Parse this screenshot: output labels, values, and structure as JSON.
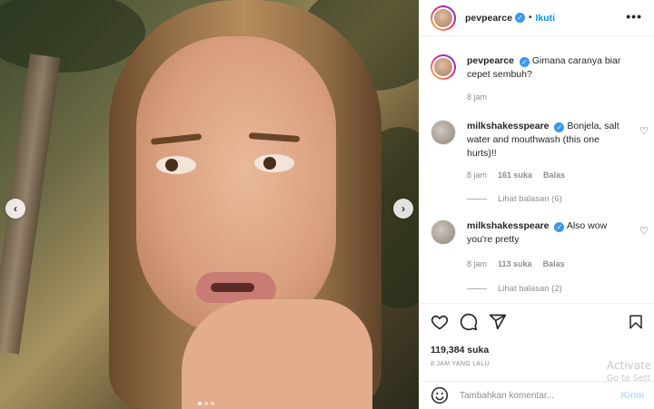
{
  "post": {
    "username": "pevpearce",
    "separator": "•",
    "follow_label": "Ikuti",
    "more_label": "•••",
    "image_alt": "photo of a woman touching her lip",
    "carousel": {
      "count": 3,
      "active": 1
    },
    "prev_label": "‹",
    "next_label": "›"
  },
  "caption": {
    "username": "pevpearce",
    "text": "Gimana caranya biar cepet sembuh?",
    "time": "8 jam"
  },
  "comments": [
    {
      "username": "milkshakesspeare",
      "text": "Bonjela, salt water and mouthwash (this one hurts)!!",
      "time": "8 jam",
      "likes": "161 suka",
      "reply_label": "Balas",
      "view_replies": "Lihat balasan (6)"
    },
    {
      "username": "milkshakesspeare",
      "text": "Also wow you're pretty",
      "time": "8 jam",
      "likes": "113 suka",
      "reply_label": "Balas",
      "view_replies": "Lihat balasan (2)"
    }
  ],
  "actions": {
    "likes": "119,384 suka",
    "timestamp": "8 JAM YANG LALU"
  },
  "composer": {
    "placeholder": "Tambahkan komentar...",
    "post_label": "Kirim"
  },
  "watermark": {
    "line1": "Activate",
    "line2": "Go to Sett"
  },
  "colors": {
    "link_blue": "#0095f6",
    "verified_blue": "#3897f0",
    "muted_text": "#8e8e8e"
  }
}
